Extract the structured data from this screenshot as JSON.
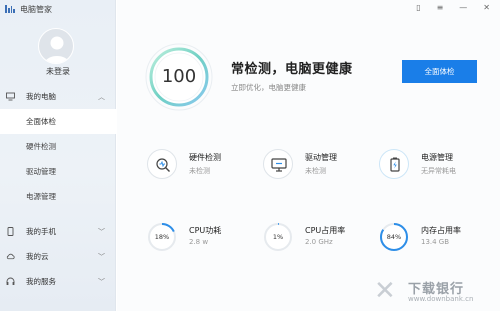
{
  "app": {
    "title": "电脑管家"
  },
  "user": {
    "login_text": "未登录"
  },
  "sidebar": {
    "groups": [
      {
        "label": "我的电脑",
        "expanded": true,
        "children": [
          "全面体检",
          "硬件检测",
          "驱动管理",
          "电源管理"
        ],
        "active_child": 0
      },
      {
        "label": "我的手机"
      },
      {
        "label": "我的云"
      },
      {
        "label": "我的服务"
      }
    ]
  },
  "window_controls": {
    "device": "▯",
    "menu": "≡",
    "minimize": "—",
    "close": "✕"
  },
  "hero": {
    "score": "100",
    "headline": "常检测，电脑更健康",
    "subline": "立即优化，电脑更健康",
    "button": "全面体检"
  },
  "cards": [
    {
      "title": "硬件检测",
      "status": "未检测",
      "icon": "hardware-scan-icon"
    },
    {
      "title": "驱动管理",
      "status": "未检测",
      "icon": "driver-icon"
    },
    {
      "title": "电源管理",
      "status": "无异常耗电",
      "icon": "power-icon"
    }
  ],
  "gauges": [
    {
      "value_text": "18%",
      "percent": 18,
      "title": "CPU功耗",
      "detail": "2.8 w"
    },
    {
      "value_text": "1%",
      "percent": 1,
      "title": "CPU占用率",
      "detail": "2.0 GHz"
    },
    {
      "value_text": "84%",
      "percent": 84,
      "title": "内存占用率",
      "detail": "13.4 GB"
    }
  ],
  "watermark": {
    "brand": "下载银行",
    "url": "www.downbank.cn"
  },
  "colors": {
    "accent": "#1a7ee8",
    "gauge_track": "#e6eaee",
    "gauge_fill": "#2d8ee8"
  }
}
